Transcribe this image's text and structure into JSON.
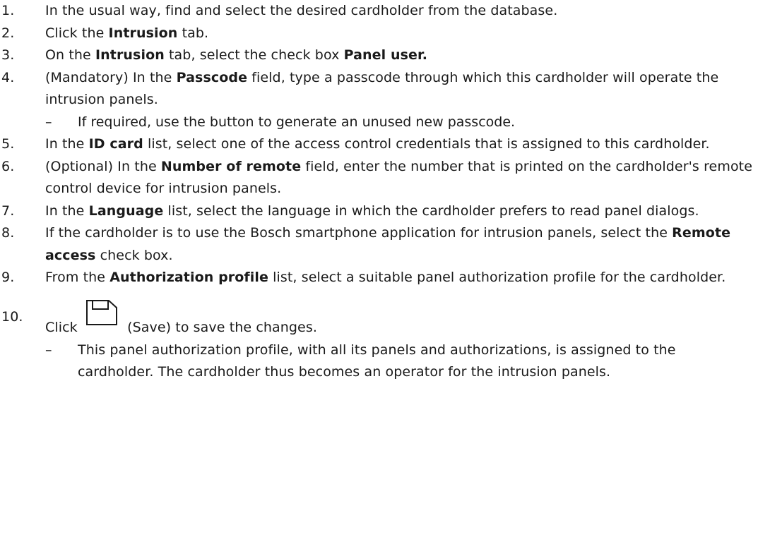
{
  "steps": [
    {
      "num": "1.",
      "parts": [
        {
          "t": "In the usual way, find and select the desired cardholder from the database."
        }
      ]
    },
    {
      "num": "2.",
      "parts": [
        {
          "t": "Click the "
        },
        {
          "t": "Intrusion",
          "b": true
        },
        {
          "t": " tab."
        }
      ]
    },
    {
      "num": "3.",
      "parts": [
        {
          "t": "On the "
        },
        {
          "t": "Intrusion",
          "b": true
        },
        {
          "t": " tab, select the check box "
        },
        {
          "t": "Panel user.",
          "b": true
        }
      ]
    },
    {
      "num": "4.",
      "parts": [
        {
          "t": "(Mandatory) In the "
        },
        {
          "t": "Passcode",
          "b": true
        },
        {
          "t": " field, type a passcode through which this cardholder will operate the intrusion panels."
        }
      ],
      "sub": "If required, use the button to generate an unused new passcode."
    },
    {
      "num": "5.",
      "parts": [
        {
          "t": "In the "
        },
        {
          "t": "ID card",
          "b": true
        },
        {
          "t": " list, select one of the access control credentials that is assigned to this cardholder."
        }
      ]
    },
    {
      "num": "6.",
      "parts": [
        {
          "t": "(Optional) In the "
        },
        {
          "t": "Number of remote",
          "b": true
        },
        {
          "t": " field, enter the number that is printed on the cardholder's remote control device for intrusion panels."
        }
      ]
    },
    {
      "num": "7.",
      "parts": [
        {
          "t": "In the "
        },
        {
          "t": "Language",
          "b": true
        },
        {
          "t": " list, select the language in which the cardholder prefers to read panel dialogs."
        }
      ]
    },
    {
      "num": "8.",
      "parts": [
        {
          "t": "If the cardholder is to use the Bosch smartphone application for intrusion panels, select the "
        },
        {
          "t": "Remote access",
          "b": true
        },
        {
          "t": " check box."
        }
      ]
    },
    {
      "num": "9.",
      "parts": [
        {
          "t": "From the "
        },
        {
          "t": "Authorization profile",
          "b": true
        },
        {
          "t": " list, select a suitable panel authorization profile for the cardholder."
        }
      ]
    }
  ],
  "step10": {
    "num": "10.",
    "before": "Click",
    "icon": "save-icon",
    "after": "(Save) to save the changes.",
    "sub": "This panel authorization profile, with all its panels and authorizations, is assigned to the cardholder. The cardholder thus becomes an operator for the intrusion panels."
  },
  "dash": "–"
}
